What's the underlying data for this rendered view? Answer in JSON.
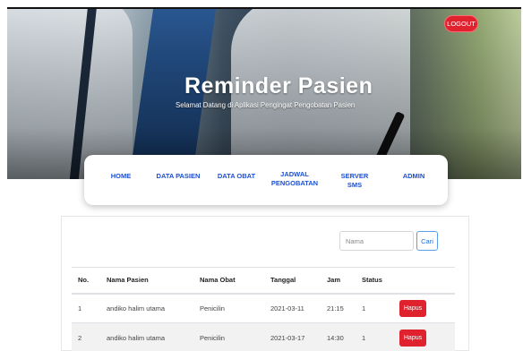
{
  "header": {
    "title": "Reminder Pasien",
    "subtitle": "Selamat Datang di Aplikasi Pengingat Pengobatan Pasien",
    "logout_label": "LOGOUT",
    "logout_color": "#e0222f"
  },
  "nav": {
    "items": [
      {
        "label": "HOME"
      },
      {
        "label": "DATA PASIEN"
      },
      {
        "label": "DATA OBAT"
      },
      {
        "label": "JADWAL\nPENGOBATAN"
      },
      {
        "label": "SERVER SMS"
      },
      {
        "label": "ADMIN"
      }
    ],
    "link_color": "#1a4fd6"
  },
  "search": {
    "placeholder": "Nama",
    "button_label": "Cari"
  },
  "table": {
    "columns": [
      "No.",
      "Nama Pasien",
      "Nama Obat",
      "Tanggal",
      "Jam",
      "Status",
      ""
    ],
    "rows": [
      {
        "no": "1",
        "nama_pasien": "andiko halim utama",
        "nama_obat": "Penicilin",
        "tanggal": "2021-03-11",
        "jam": "21:15",
        "status": "1",
        "action": "Hapus"
      },
      {
        "no": "2",
        "nama_pasien": "andiko halim utama",
        "nama_obat": "Penicilin",
        "tanggal": "2021-03-17",
        "jam": "14:30",
        "status": "1",
        "action": "Hapus"
      }
    ],
    "delete_color": "#e0222f"
  }
}
